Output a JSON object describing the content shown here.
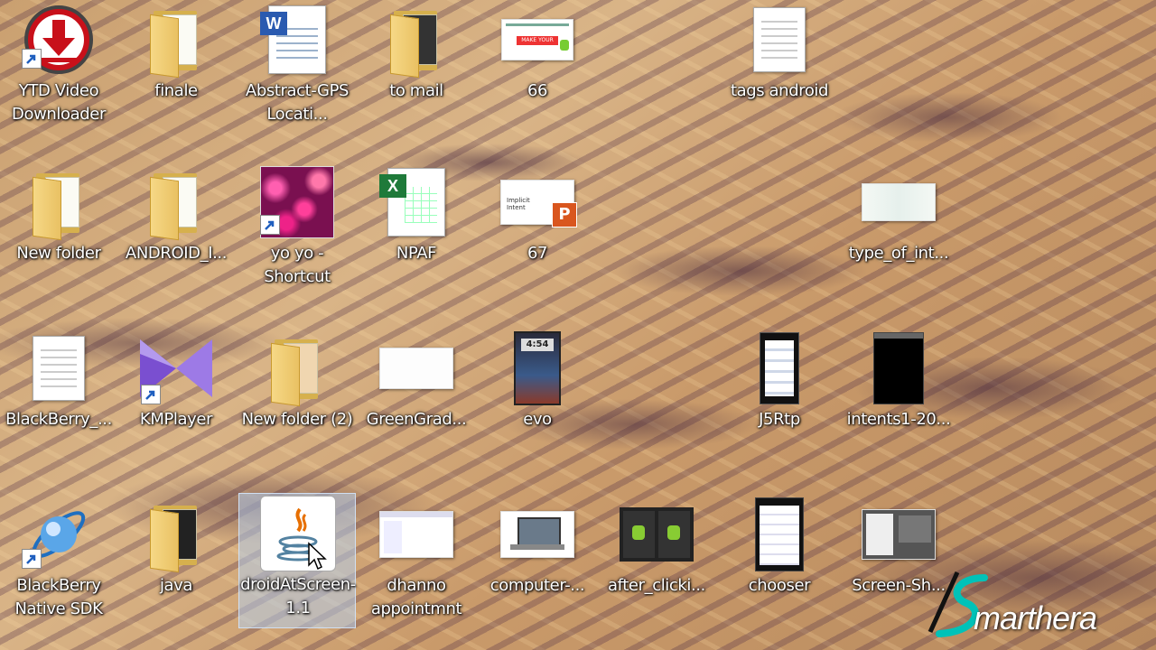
{
  "desktop": {
    "icons": [
      {
        "label": "YTD Video Downloader",
        "icon": "ytd-icon"
      },
      {
        "label": "finale",
        "icon": "folder-icon"
      },
      {
        "label": "Abstract-GPS Locati...",
        "icon": "word-document-icon"
      },
      {
        "label": "to mail",
        "icon": "folder-icon"
      },
      {
        "label": "66",
        "icon": "image-thumbnail-icon"
      },
      {
        "label": "tags android",
        "icon": "text-file-icon"
      },
      {
        "label": "New folder",
        "icon": "folder-icon"
      },
      {
        "label": "ANDROID_I...",
        "icon": "folder-icon"
      },
      {
        "label": "yo yo - Shortcut",
        "icon": "flowers-image-icon"
      },
      {
        "label": "NPAF",
        "icon": "excel-document-icon"
      },
      {
        "label": "67",
        "icon": "powerpoint-document-icon"
      },
      {
        "label": "type_of_int...",
        "icon": "image-thumbnail-icon"
      },
      {
        "label": "BlackBerry_...",
        "icon": "text-file-icon"
      },
      {
        "label": "KMPlayer",
        "icon": "kmplayer-icon"
      },
      {
        "label": "New folder (2)",
        "icon": "folder-icon"
      },
      {
        "label": "GreenGrad...",
        "icon": "image-thumbnail-icon"
      },
      {
        "label": "evo",
        "icon": "phone-screenshot-icon"
      },
      {
        "label": "J5Rtp",
        "icon": "phone-screenshot-icon"
      },
      {
        "label": "intents1-20...",
        "icon": "phone-screenshot-icon"
      },
      {
        "label": "BlackBerry Native SDK",
        "icon": "blackberry-sdk-icon"
      },
      {
        "label": "java",
        "icon": "folder-icon"
      },
      {
        "label": "droidAtScreen-1.1",
        "icon": "java-jar-icon",
        "selected": true
      },
      {
        "label": "dhanno appointmnt",
        "icon": "image-thumbnail-icon"
      },
      {
        "label": "computer-...",
        "icon": "laptop-image-icon"
      },
      {
        "label": "after_clicki...",
        "icon": "android-screens-icon"
      },
      {
        "label": "chooser",
        "icon": "phone-screenshot-icon"
      },
      {
        "label": "Screen-Sh...",
        "icon": "screenshot-image-icon"
      }
    ],
    "thumb_texts": {
      "t66": "MAKE YOUR APP",
      "t67": "Implicit Intent",
      "evo_time": "4:54"
    }
  },
  "watermark": {
    "text": "marthera",
    "icon": "smarthera-logo-icon",
    "accent": "#00c2b8"
  },
  "colors": {
    "selection": "#b4cdeb",
    "label_text": "#ffffff",
    "folder": "#e9c163"
  }
}
